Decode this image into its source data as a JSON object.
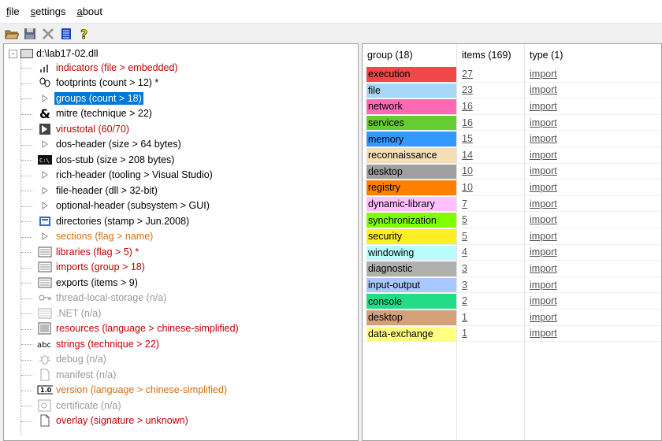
{
  "menu": [
    {
      "label": "file",
      "ul": "f",
      "rest": "ile"
    },
    {
      "label": "settings",
      "ul": "s",
      "rest": "ettings"
    },
    {
      "label": "about",
      "ul": "a",
      "rest": "bout"
    }
  ],
  "toolbar": [
    "open-folder-icon",
    "save-icon",
    "close-icon",
    "notepad-icon",
    "help-icon"
  ],
  "tree": {
    "root": "d:\\lab17-02.dll",
    "selected": "groups (count > 18)",
    "items": [
      {
        "label": "indicators (file > embedded)",
        "color": "red",
        "icon": "indicators-icon"
      },
      {
        "label": "footprints (count > 12) *",
        "color": "black",
        "icon": "footprints-icon"
      },
      {
        "label": "groups (count > 18)",
        "color": "selected",
        "icon": "groups-icon"
      },
      {
        "label": "mitre (technique > 22)",
        "color": "black",
        "icon": "mitre-icon"
      },
      {
        "label": "virustotal (60/70)",
        "color": "red",
        "icon": "virustotal-icon"
      },
      {
        "label": "dos-header (size > 64 bytes)",
        "color": "black",
        "icon": "dos-header-icon"
      },
      {
        "label": "dos-stub (size > 208 bytes)",
        "color": "black",
        "icon": "dos-stub-icon"
      },
      {
        "label": "rich-header (tooling > Visual Studio)",
        "color": "black",
        "icon": "rich-header-icon"
      },
      {
        "label": "file-header (dll > 32-bit)",
        "color": "black",
        "icon": "file-header-icon"
      },
      {
        "label": "optional-header (subsystem > GUI)",
        "color": "black",
        "icon": "optional-header-icon"
      },
      {
        "label": "directories (stamp > Jun.2008)",
        "color": "black",
        "icon": "directories-icon"
      },
      {
        "label": "sections (flag > name)",
        "color": "orange",
        "icon": "sections-icon"
      },
      {
        "label": "libraries (flag > 5) *",
        "color": "red",
        "icon": "libraries-icon"
      },
      {
        "label": "imports (group > 18)",
        "color": "red",
        "icon": "imports-icon"
      },
      {
        "label": "exports (items > 9)",
        "color": "black",
        "icon": "exports-icon"
      },
      {
        "label": "thread-local-storage (n/a)",
        "color": "gray",
        "icon": "tls-icon"
      },
      {
        "label": ".NET (n/a)",
        "color": "gray",
        "icon": "dotnet-icon"
      },
      {
        "label": "resources (language > chinese-simplified)",
        "color": "red",
        "icon": "resources-icon"
      },
      {
        "label": "strings (technique > 22)",
        "color": "red",
        "icon": "strings-icon"
      },
      {
        "label": "debug (n/a)",
        "color": "gray",
        "icon": "debug-icon"
      },
      {
        "label": "manifest (n/a)",
        "color": "gray",
        "icon": "manifest-icon"
      },
      {
        "label": "version (language > chinese-simplified)",
        "color": "orange",
        "icon": "version-icon"
      },
      {
        "label": "certificate (n/a)",
        "color": "gray",
        "icon": "certificate-icon"
      },
      {
        "label": "overlay (signature > unknown)",
        "color": "red",
        "icon": "overlay-icon"
      }
    ]
  },
  "table": {
    "headers": [
      "group (18)",
      "items (169)",
      "type (1)"
    ],
    "rows": [
      {
        "group": "execution",
        "items": "27",
        "type": "import",
        "color": "#f04848"
      },
      {
        "group": "file",
        "items": "23",
        "type": "import",
        "color": "#a8d8f8"
      },
      {
        "group": "network",
        "items": "16",
        "type": "import",
        "color": "#ff69b4"
      },
      {
        "group": "services",
        "items": "16",
        "type": "import",
        "color": "#66cc33"
      },
      {
        "group": "memory",
        "items": "15",
        "type": "import",
        "color": "#3399ff"
      },
      {
        "group": "reconnaissance",
        "items": "14",
        "type": "import",
        "color": "#f5deb3"
      },
      {
        "group": "desktop",
        "items": "10",
        "type": "import",
        "color": "#a0a0a0"
      },
      {
        "group": "registry",
        "items": "10",
        "type": "import",
        "color": "#ff8000"
      },
      {
        "group": "dynamic-library",
        "items": "7",
        "type": "import",
        "color": "#ffc0ff"
      },
      {
        "group": "synchronization",
        "items": "5",
        "type": "import",
        "color": "#80ff00"
      },
      {
        "group": "security",
        "items": "5",
        "type": "import",
        "color": "#ffee22"
      },
      {
        "group": "windowing",
        "items": "4",
        "type": "import",
        "color": "#b8fcfc"
      },
      {
        "group": "diagnostic",
        "items": "3",
        "type": "import",
        "color": "#b0b0b0"
      },
      {
        "group": "input-output",
        "items": "3",
        "type": "import",
        "color": "#a8c8ff"
      },
      {
        "group": "console",
        "items": "2",
        "type": "import",
        "color": "#22dd88"
      },
      {
        "group": "desktop",
        "items": "1",
        "type": "import",
        "color": "#d4a07a"
      },
      {
        "group": "data-exchange",
        "items": "1",
        "type": "import",
        "color": "#ffff80"
      }
    ]
  }
}
